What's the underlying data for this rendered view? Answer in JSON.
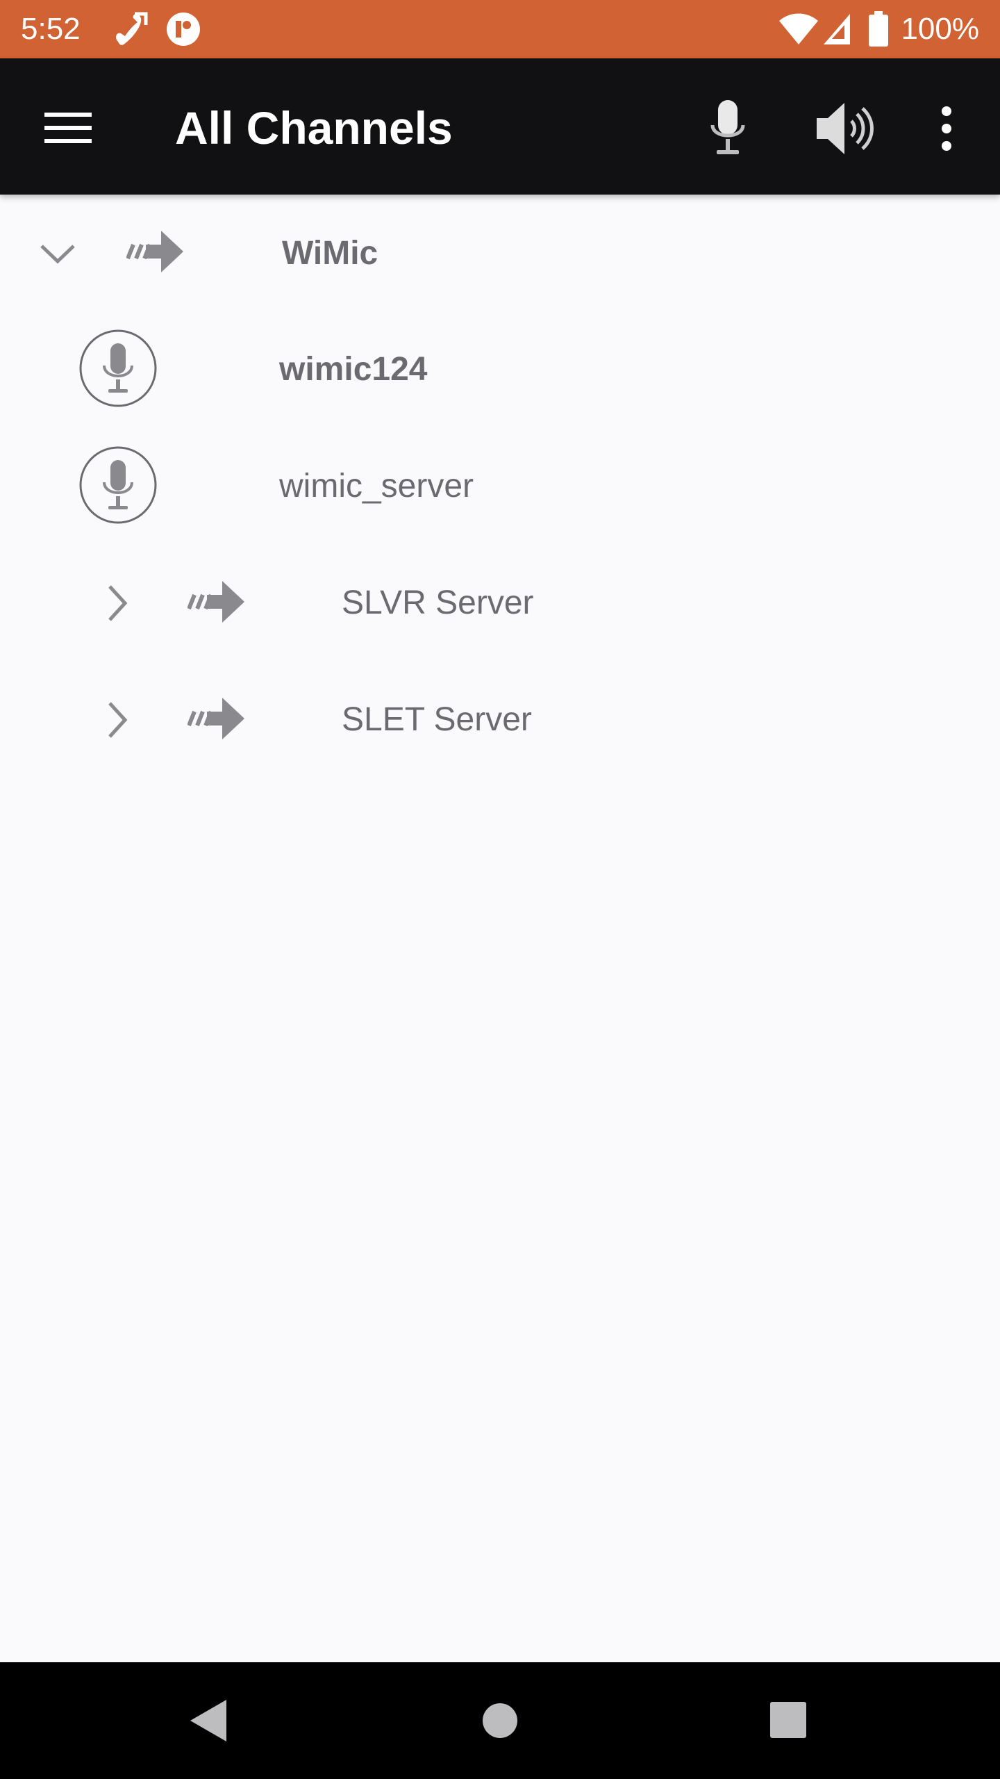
{
  "status_bar": {
    "time": "5:52",
    "battery": "100%",
    "icons": [
      "call-forward-icon",
      "app-notification-icon",
      "wifi-icon",
      "signal-icon",
      "battery-icon"
    ]
  },
  "app_bar": {
    "title": "All Channels",
    "actions": [
      "menu-icon",
      "microphone-icon",
      "speaker-icon",
      "more-vert-icon"
    ]
  },
  "tree": {
    "items": [
      {
        "label": "WiMic",
        "type": "channel",
        "expanded": true
      },
      {
        "label": "wimic124",
        "type": "user"
      },
      {
        "label": "wimic_server",
        "type": "user"
      },
      {
        "label": "SLVR Server",
        "type": "channel",
        "expanded": false
      },
      {
        "label": "SLET Server",
        "type": "channel",
        "expanded": false
      }
    ]
  },
  "nav_bar": {
    "buttons": [
      "back-icon",
      "home-icon",
      "recents-icon"
    ]
  },
  "colors": {
    "status_bar": "#d06233",
    "app_bar": "#111113",
    "background": "#faf9fb",
    "text": "#6a6a70",
    "icon": "#8a8a8e"
  }
}
